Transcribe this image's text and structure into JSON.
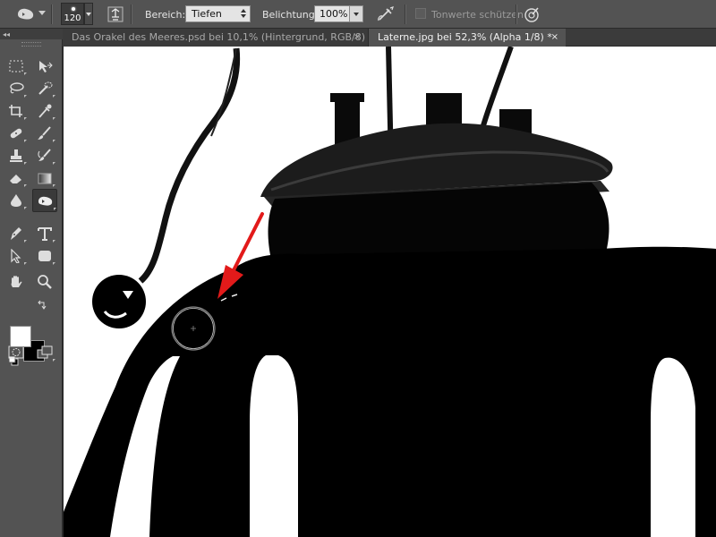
{
  "options_bar": {
    "tool_icon": "burn-tool-icon",
    "brush_size": "120",
    "range_label": "Bereich:",
    "range_value": "Tiefen",
    "exposure_label": "Belichtung:",
    "exposure_value": "100%",
    "protect_tones_label": "Tonwerte schützen",
    "protect_tones_checked": false
  },
  "toolbox": {
    "collapse_label": "◂◂",
    "icons": [
      "rectangular-marquee-icon",
      "move-icon",
      "lasso-icon",
      "quick-selection-icon",
      "crop-icon",
      "eyedropper-icon",
      "spot-healing-icon",
      "brush-icon",
      "clone-stamp-icon",
      "history-brush-icon",
      "eraser-icon",
      "gradient-icon",
      "blur-icon",
      "burn-tool-icon",
      "pen-icon",
      "type-icon",
      "path-selection-icon",
      "shape-icon",
      "hand-icon",
      "zoom-icon",
      "quick-mask-icon",
      "screen-mode-icon"
    ],
    "foreground_color": "#ffffff",
    "background_color": "#000000"
  },
  "tabs": [
    {
      "label": "Das Orakel des Meeres.psd bei 10,1% (Hintergrund, RGB/8) *",
      "close": "×",
      "active": false
    },
    {
      "label": "Laterne.jpg bei 52,3% (Alpha 1/8) *",
      "close": "×",
      "active": true
    }
  ],
  "canvas": {
    "image": "lantern-alpha-channel-image",
    "annotation": "red-arrow",
    "annotation_color": "#e21a1a"
  }
}
